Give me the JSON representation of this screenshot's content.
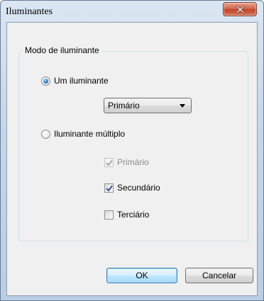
{
  "window": {
    "title": "Iluminantes",
    "close_icon": "close-x-icon"
  },
  "group": {
    "label": "Modo de iluminante"
  },
  "single": {
    "label": "Um iluminante",
    "selected": true,
    "dropdown_value": "Primário"
  },
  "multiple": {
    "label": "Iluminante múltiplo",
    "selected": false,
    "options": [
      {
        "label": "Primário",
        "checked": true,
        "enabled": false
      },
      {
        "label": "Secundário",
        "checked": true,
        "enabled": true
      },
      {
        "label": "Terciário",
        "checked": false,
        "enabled": true
      }
    ]
  },
  "buttons": {
    "ok": "OK",
    "cancel": "Cancelar"
  },
  "colors": {
    "accent": "#2a78c2",
    "close_button": "#c0452a",
    "disabled_text": "#8b8b8b"
  }
}
